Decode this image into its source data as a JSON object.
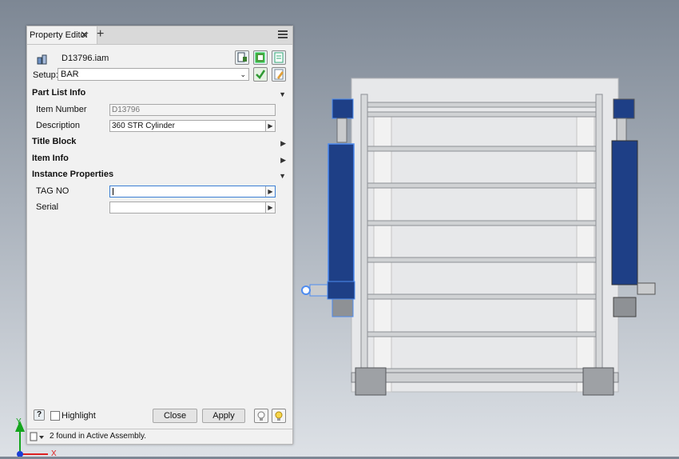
{
  "panel": {
    "tab_label": "Property Editor",
    "close_glyph": "✕",
    "add_glyph": "+",
    "file_name": "D13796.iam",
    "setup_label": "Setup:",
    "setup_value": "BAR",
    "sections": {
      "part_list": "Part List Info",
      "title_block": "Title Block",
      "item_info": "Item Info",
      "instance": "Instance Properties"
    },
    "fields": {
      "item_number_label": "Item Number",
      "item_number_value": "D13796",
      "description_label": "Description",
      "description_value": "360 STR Cylinder",
      "tag_no_label": "TAG NO",
      "tag_no_value": "",
      "serial_label": "Serial",
      "serial_value": ""
    },
    "footer": {
      "highlight_label": "Highlight",
      "close": "Close",
      "apply": "Apply",
      "help_glyph": "?"
    },
    "status_text": "2 found in Active Assembly."
  },
  "axes": {
    "y": "Y",
    "x": "X"
  },
  "colors": {
    "accent": "#3c7fd4",
    "cylinder": "#1e3f86",
    "frame": "#d3d5d7"
  }
}
